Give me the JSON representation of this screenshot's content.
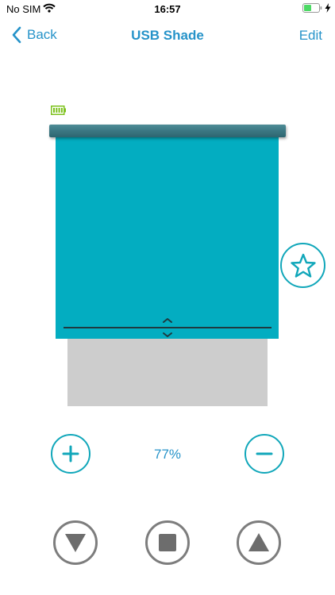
{
  "status_bar": {
    "carrier": "No SIM",
    "time": "16:57"
  },
  "nav": {
    "back_label": "Back",
    "title": "USB Shade",
    "edit_label": "Edit"
  },
  "shade": {
    "position_percent_text": "77%",
    "position_percent": 77
  },
  "icons": {
    "wifi": "wifi-icon",
    "battery": "battery-icon",
    "charging": "bolt-icon",
    "shade_battery": "device-battery-icon",
    "favorite": "star-icon",
    "adjust": "up-down-chevron-icon",
    "plus": "plus-icon",
    "minus": "minus-icon",
    "down": "down-triangle-icon",
    "stop": "stop-square-icon",
    "up": "up-triangle-icon"
  },
  "colors": {
    "accent": "#2693c9",
    "fabric": "#03adc1",
    "window": "#cdcdcd",
    "control_grey": "#7d7d7d",
    "battery_green": "#7dc21e"
  }
}
